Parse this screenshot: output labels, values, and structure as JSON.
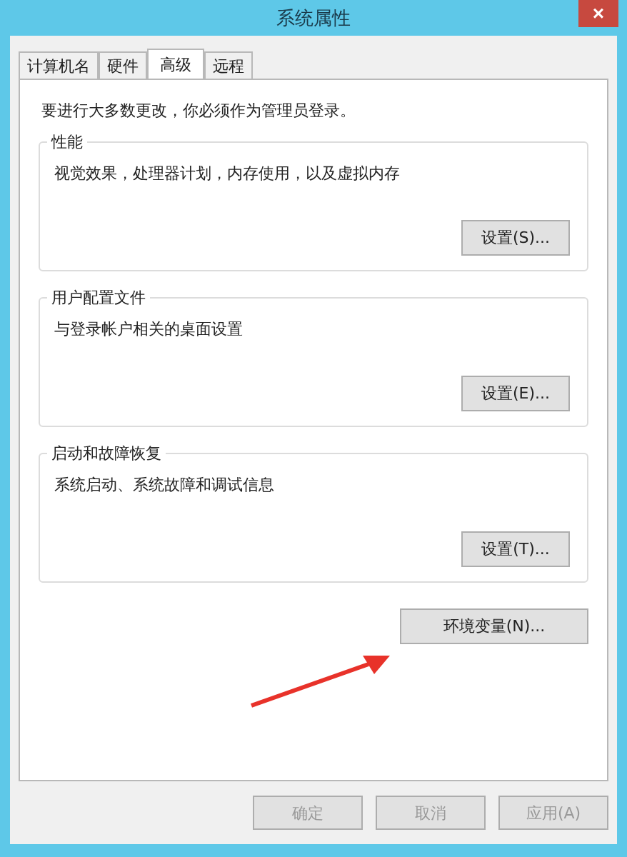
{
  "window": {
    "title": "系统属性",
    "close": "×"
  },
  "tabs": [
    {
      "label": "计算机名",
      "selected": false
    },
    {
      "label": "硬件",
      "selected": false
    },
    {
      "label": "高级",
      "selected": true
    },
    {
      "label": "远程",
      "selected": false
    }
  ],
  "notice": "要进行大多数更改，你必须作为管理员登录。",
  "groups": [
    {
      "title": "性能",
      "description": "视觉效果，处理器计划，内存使用，以及虚拟内存",
      "button": "设置(S)..."
    },
    {
      "title": "用户配置文件",
      "description": "与登录帐户相关的桌面设置",
      "button": "设置(E)..."
    },
    {
      "title": "启动和故障恢复",
      "description": "系统启动、系统故障和调试信息",
      "button": "设置(T)..."
    }
  ],
  "env_button": "环境变量(N)...",
  "buttons": [
    "确定",
    "取消",
    "应用(A)"
  ]
}
